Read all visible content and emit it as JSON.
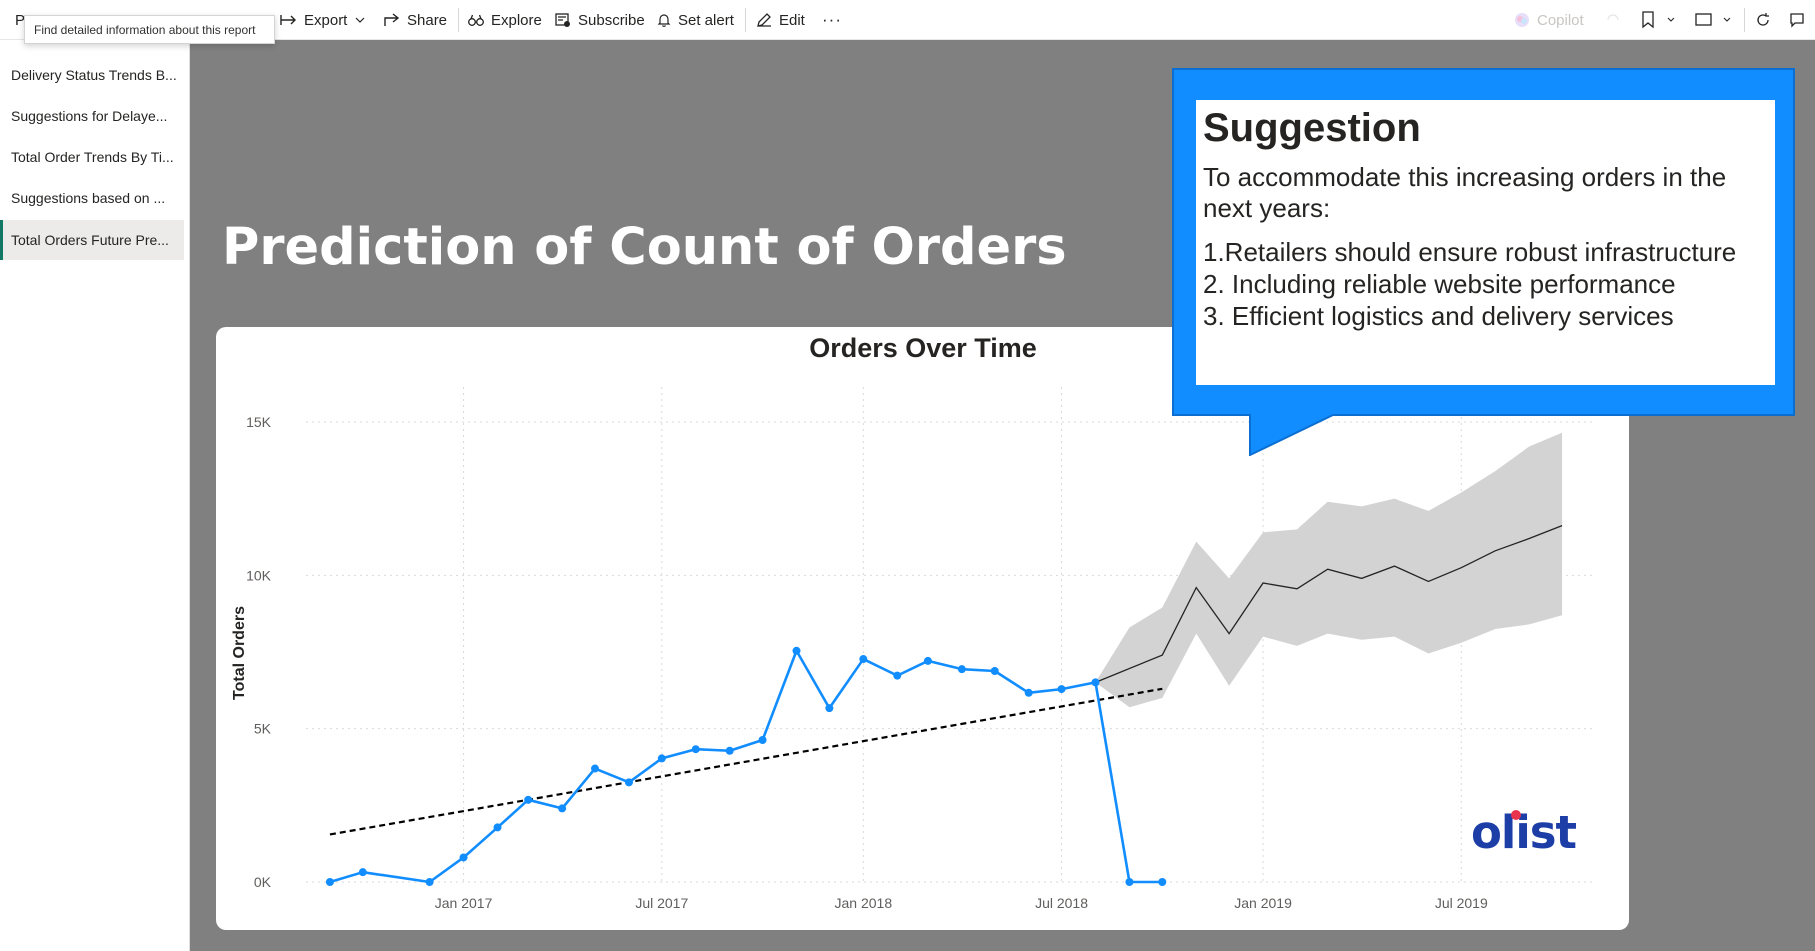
{
  "toolbar": {
    "left_initial": "P",
    "items": [
      {
        "label": "Export",
        "icon": "export-icon"
      },
      {
        "label": "Share",
        "icon": "share-icon"
      },
      {
        "label": "Explore",
        "icon": "binoculars-icon"
      },
      {
        "label": "Subscribe",
        "icon": "subscribe-icon"
      },
      {
        "label": "Set alert",
        "icon": "bell-icon"
      },
      {
        "label": "Edit",
        "icon": "pencil-icon"
      }
    ],
    "more": "···",
    "copilot": "Copilot",
    "tooltip": "Find detailed information about this report"
  },
  "sidebar": {
    "pages": [
      {
        "label": "Delivery Status Trends B...",
        "active": false
      },
      {
        "label": "Suggestions for Delaye...",
        "active": false
      },
      {
        "label": "Total Order Trends By Ti...",
        "active": false
      },
      {
        "label": "Suggestions based on ...",
        "active": false
      },
      {
        "label": "Total Orders Future Pre...",
        "active": true
      }
    ]
  },
  "report": {
    "title": "Prediction of Count of Orders",
    "logo_text": "olist"
  },
  "callout": {
    "title": "Suggestion",
    "intro": "To accommodate this increasing orders in the next years:",
    "items": [
      "1.Retailers should ensure robust infrastructure",
      "2. Including reliable website performance",
      "3. Efficient logistics and delivery services"
    ]
  },
  "colors": {
    "actual_line": "#118dff",
    "forecast_line": "#252423",
    "forecast_band": "#d3d3d3",
    "trend_line": "#000000",
    "callout_blue": "#118dff",
    "logo_blue": "#1c3ea6",
    "active_page_accent": "#117865"
  },
  "chart_data": {
    "type": "line",
    "title": "Orders Over Time",
    "ylabel": "Total Orders",
    "xlabel": "",
    "y_ticks": [
      "0K",
      "5K",
      "10K",
      "15K"
    ],
    "y_tick_values": [
      0,
      5000,
      10000,
      15000
    ],
    "x_ticks": [
      "Jan 2017",
      "Jul 2017",
      "Jan 2018",
      "Jul 2018",
      "Jan 2019",
      "Jul 2019"
    ],
    "x_tick_dates": [
      "2017-01-01",
      "2017-07-01",
      "2018-01-01",
      "2018-07-01",
      "2019-01-01",
      "2019-07-01"
    ],
    "ylim": [
      0,
      15000
    ],
    "xlim": [
      "2016-08-01",
      "2019-11-01"
    ],
    "grid": true,
    "series": [
      {
        "kind": "actual",
        "points": [
          {
            "x": "2016-09-01",
            "y": 0
          },
          {
            "x": "2016-10-01",
            "y": 320
          },
          {
            "x": "2016-12-01",
            "y": 0
          },
          {
            "x": "2017-01-01",
            "y": 800
          },
          {
            "x": "2017-02-01",
            "y": 1780
          },
          {
            "x": "2017-03-01",
            "y": 2680
          },
          {
            "x": "2017-04-01",
            "y": 2400
          },
          {
            "x": "2017-05-01",
            "y": 3700
          },
          {
            "x": "2017-06-01",
            "y": 3250
          },
          {
            "x": "2017-07-01",
            "y": 4030
          },
          {
            "x": "2017-08-01",
            "y": 4330
          },
          {
            "x": "2017-09-01",
            "y": 4280
          },
          {
            "x": "2017-10-01",
            "y": 4630
          },
          {
            "x": "2017-11-01",
            "y": 7540
          },
          {
            "x": "2017-12-01",
            "y": 5670
          },
          {
            "x": "2018-01-01",
            "y": 7270
          },
          {
            "x": "2018-02-01",
            "y": 6730
          },
          {
            "x": "2018-03-01",
            "y": 7210
          },
          {
            "x": "2018-04-01",
            "y": 6940
          },
          {
            "x": "2018-05-01",
            "y": 6880
          },
          {
            "x": "2018-06-01",
            "y": 6170
          },
          {
            "x": "2018-07-01",
            "y": 6290
          },
          {
            "x": "2018-08-01",
            "y": 6510
          },
          {
            "x": "2018-09-01",
            "y": 0
          },
          {
            "x": "2018-10-01",
            "y": 0
          }
        ]
      },
      {
        "kind": "forecast",
        "points": [
          {
            "x": "2018-08-01",
            "y": 6510
          },
          {
            "x": "2018-10-01",
            "y": 7400
          },
          {
            "x": "2018-11-01",
            "y": 9600
          },
          {
            "x": "2018-12-01",
            "y": 8100
          },
          {
            "x": "2019-01-01",
            "y": 9750
          },
          {
            "x": "2019-02-01",
            "y": 9560
          },
          {
            "x": "2019-03-01",
            "y": 10200
          },
          {
            "x": "2019-04-01",
            "y": 9900
          },
          {
            "x": "2019-05-01",
            "y": 10300
          },
          {
            "x": "2019-06-01",
            "y": 9800
          },
          {
            "x": "2019-07-01",
            "y": 10250
          },
          {
            "x": "2019-08-01",
            "y": 10800
          },
          {
            "x": "2019-09-01",
            "y": 11200
          },
          {
            "x": "2019-10-01",
            "y": 11620
          }
        ],
        "band_upper": [
          6510,
          8300,
          8950,
          11100,
          9900,
          11400,
          11500,
          12400,
          12250,
          12500,
          12100,
          12700,
          13400,
          14200,
          14650
        ],
        "band_lower": [
          6510,
          5700,
          6000,
          8100,
          6400,
          8000,
          7700,
          8100,
          7900,
          8000,
          7450,
          7800,
          8250,
          8400,
          8700
        ],
        "band_x": [
          "2018-08-01",
          "2018-09-01",
          "2018-10-01",
          "2018-11-01",
          "2018-12-01",
          "2019-01-01",
          "2019-02-01",
          "2019-03-01",
          "2019-04-01",
          "2019-05-01",
          "2019-06-01",
          "2019-07-01",
          "2019-08-01",
          "2019-09-01",
          "2019-10-01"
        ]
      },
      {
        "kind": "trend",
        "points": [
          {
            "x": "2016-09-01",
            "y": 1550
          },
          {
            "x": "2018-10-01",
            "y": 6300
          }
        ]
      }
    ]
  }
}
